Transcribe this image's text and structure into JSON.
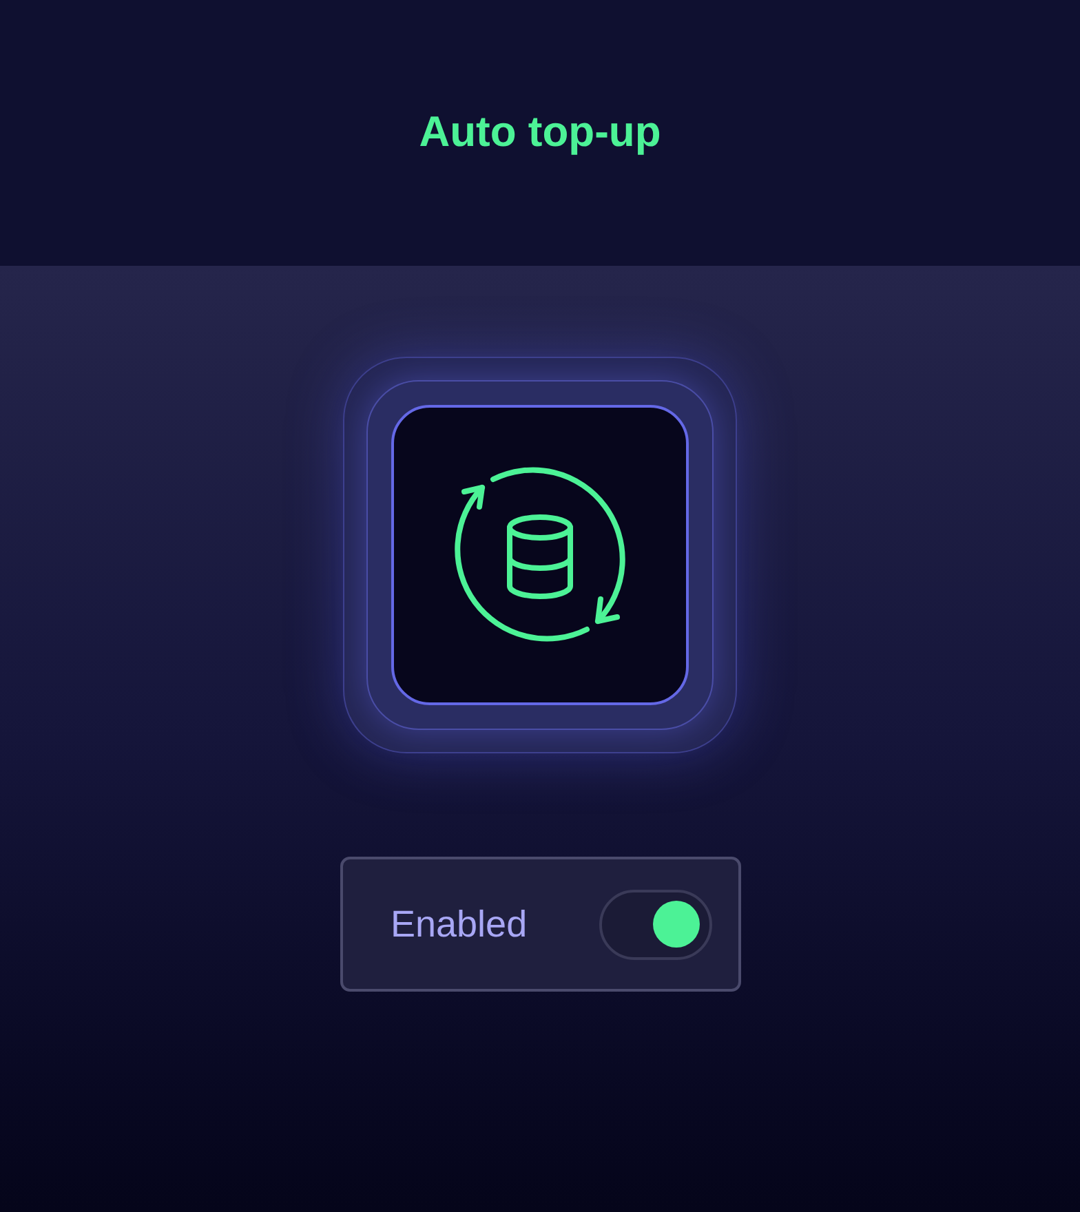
{
  "header": {
    "title": "Auto top-up"
  },
  "toggle": {
    "label": "Enabled",
    "on": true
  }
}
